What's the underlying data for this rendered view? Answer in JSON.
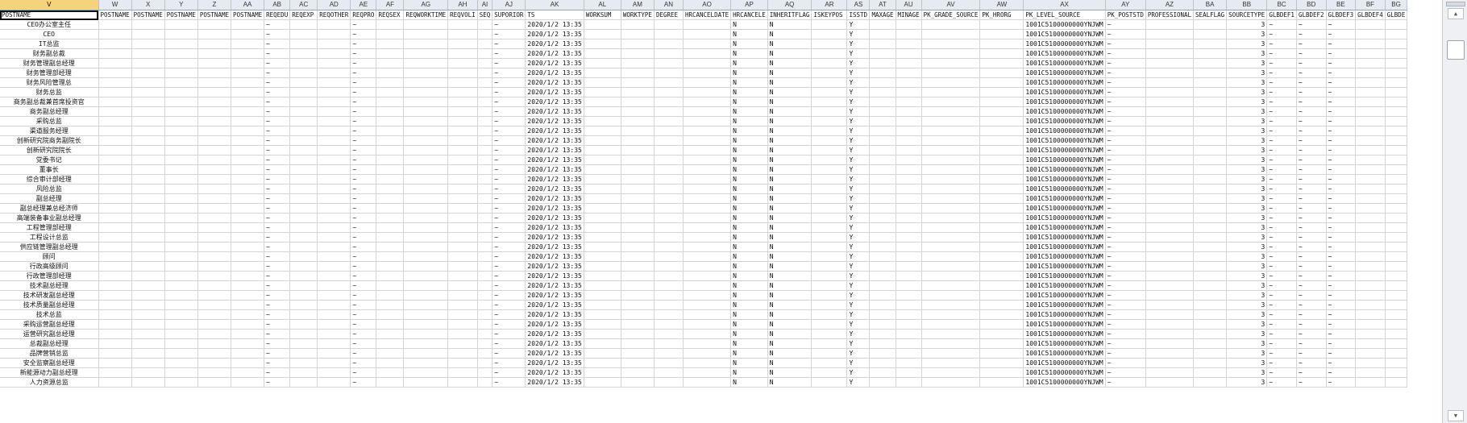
{
  "columns": [
    "V",
    "W",
    "X",
    "Y",
    "Z",
    "AA",
    "AB",
    "AC",
    "AD",
    "AE",
    "AF",
    "AG",
    "AH",
    "AI",
    "AJ",
    "AK",
    "AL",
    "AM",
    "AN",
    "AO",
    "AP",
    "AQ",
    "AR",
    "AS",
    "AT",
    "AU",
    "AV",
    "AW",
    "AX",
    "AY",
    "AZ",
    "BA",
    "BB",
    "BC",
    "BD",
    "BE",
    "BF",
    "BG"
  ],
  "selected_column": "V",
  "field_names": [
    "POSTNAME",
    "POSTNAME",
    "POSTNAME",
    "POSTNAME",
    "POSTNAME",
    "POSTNAME",
    "REQEDU",
    "REQEXP",
    "REQOTHER",
    "REQPRO",
    "REQSEX",
    "REQWORKTIME",
    "REQVOLI",
    "SEQ",
    "SUPORIOR",
    "TS",
    "WORKSUM",
    "WORKTYPE",
    "DEGREE",
    "HRCANCELDATE",
    "HRCANCELE",
    "INHERITFLAG",
    "ISKEYPOS",
    "ISSTD",
    "MAXAGE",
    "MINAGE",
    "PK_GRADE_SOURCE",
    "PK_HRORG",
    "PK_LEVEL_SOURCE",
    "PK_POSTSTD",
    "PROFESSIONAL",
    "SEALFLAG",
    "SOURCETYPE",
    "GLBDEF1",
    "GLBDEF2",
    "GLBDEF3",
    "GLBDEF4",
    "GLBDE"
  ],
  "post_names": [
    "CEO办公室主任",
    "CEO",
    "IT总监",
    "财务副总裁",
    "财务管理副总经理",
    "财务管理部经理",
    "财务风险管理总",
    "财务总监",
    "商务副总裁兼首席投资官",
    "商务副总经理",
    "采购总监",
    "渠道服务经理",
    "创新研究院商务副院长",
    "创新研究院院长",
    "党委书记",
    "董事长",
    "综合审计部经理",
    "风险总监",
    "副总经理",
    "副总经理兼总经济师",
    "高端装备事业副总经理",
    "工程管理部经理",
    "工程设计总监",
    "供应链管理副总经理",
    "顾问",
    "行政高级顾问",
    "行政管理部经理",
    "技术副总经理",
    "技术研发副总经理",
    "技术质量副总经理",
    "技术总监",
    "采购运营副总经理",
    "运营研究副总经理",
    "总裁副总经理",
    "品牌营销总监",
    "安全监察副总经理",
    "新能源动力副总经理",
    "人力资源总监"
  ],
  "tilde": "~",
  "ts_value": "2020/1/2 13:35",
  "hrcancel_value": "N",
  "inherit_value": "N",
  "isstd_values": [
    "Y",
    "Y",
    "Y",
    "Y",
    "Y",
    "Y",
    "Y",
    "Y",
    "Y",
    "Y",
    "Y",
    "Y",
    "Y",
    "Y",
    "Y",
    "Y",
    "Y",
    "Y",
    "Y",
    "Y",
    "Y",
    "Y",
    "Y",
    "Y",
    "Y",
    "Y",
    "Y",
    "Y",
    "Y",
    "Y",
    "Y",
    "Y",
    "Y",
    "Y",
    "Y",
    "Y",
    "Y",
    "Y"
  ],
  "pk_level_value": "1001C5100000000YNJWM",
  "sourcetype_value": "3"
}
